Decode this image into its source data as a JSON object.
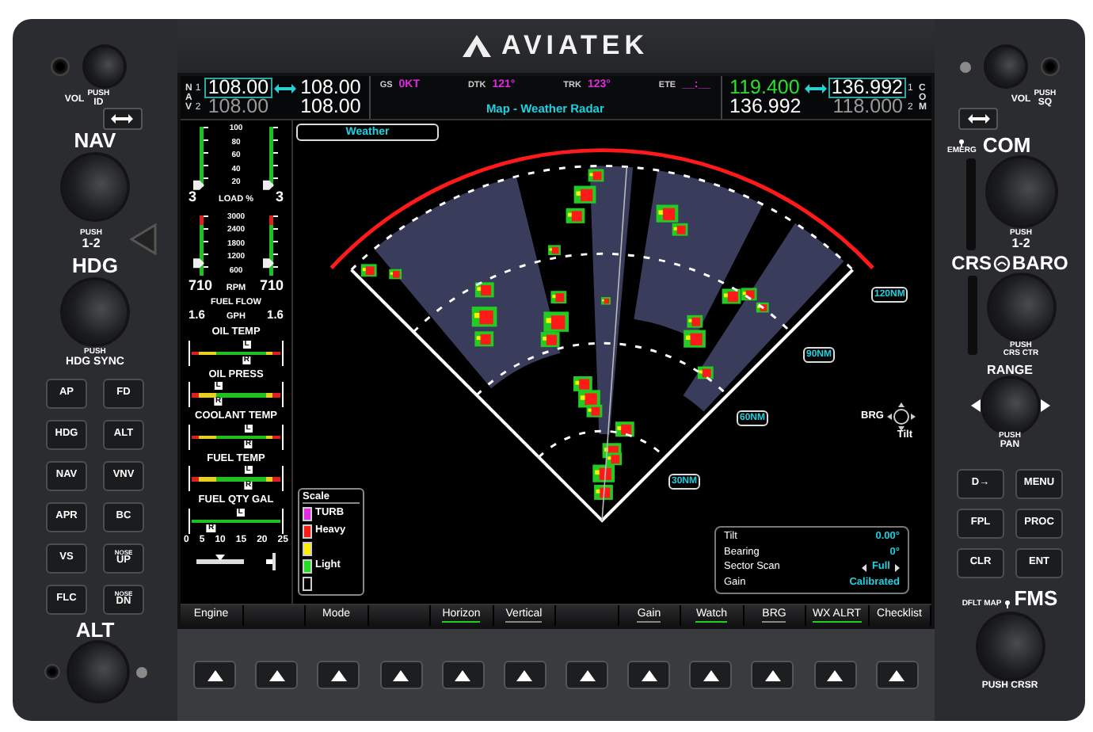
{
  "brand": {
    "name": "AVIATEK"
  },
  "left_bezel": {
    "volume": {
      "label": "VOL",
      "push": "PUSH",
      "sub": "ID"
    },
    "nav_knob": {
      "title": "NAV",
      "push": "PUSH",
      "sub": "1-2"
    },
    "hdg_knob": {
      "title": "HDG",
      "push": "PUSH",
      "sub": "HDG SYNC"
    },
    "buttons": [
      {
        "label": "AP"
      },
      {
        "label": "FD"
      },
      {
        "label": "HDG"
      },
      {
        "label": "ALT"
      },
      {
        "label": "NAV"
      },
      {
        "label": "VNV"
      },
      {
        "label": "APR"
      },
      {
        "label": "BC"
      },
      {
        "label": "VS"
      },
      {
        "small": "NOSE",
        "label": "UP"
      },
      {
        "label": "FLC"
      },
      {
        "small": "NOSE",
        "label": "DN"
      }
    ],
    "alt_knob": {
      "title": "ALT"
    }
  },
  "top_bar": {
    "nav": {
      "letters": [
        "N",
        "A",
        "V"
      ],
      "radios": [
        {
          "index": "1",
          "active": "108.00",
          "standby": "108.00",
          "selected": true
        },
        {
          "index": "2",
          "active": "108.00",
          "standby": "108.00",
          "selected": false
        }
      ]
    },
    "fields": [
      {
        "label": "GS",
        "value": "0KT"
      },
      {
        "label": "DTK",
        "value": "121°"
      },
      {
        "label": "TRK",
        "value": "123°"
      },
      {
        "label": "ETE",
        "value": "__:__"
      }
    ],
    "page_title": "Map - Weather Radar",
    "com": {
      "letters": [
        "C",
        "O",
        "M"
      ],
      "radios": [
        {
          "index": "1",
          "active": "119.400",
          "standby": "136.992",
          "selected": true
        },
        {
          "index": "2",
          "active": "136.992",
          "standby": "118.000",
          "selected": false
        }
      ]
    }
  },
  "engine": {
    "vertical_gauges": [
      {
        "ticks": [
          "100",
          "80",
          "60",
          "40",
          "20"
        ],
        "left_value": "3",
        "unit": "LOAD %",
        "right_value": "3",
        "kind": "load",
        "level": 0.03
      },
      {
        "ticks": [
          "3000",
          "2400",
          "1800",
          "1200",
          "600"
        ],
        "left_value": "710",
        "unit": "RPM",
        "right_value": "710",
        "kind": "rpm",
        "level": 0.22
      }
    ],
    "fuel_flow": {
      "label": "FUEL FLOW",
      "left_value": "1.6",
      "unit": "GPH",
      "right_value": "1.6"
    },
    "bar_gauges": [
      {
        "label": "OIL TEMP",
        "pointers": [
          {
            "tag": "L",
            "level": 0.62
          },
          {
            "tag": "R",
            "level": 0.62
          }
        ]
      },
      {
        "label": "OIL PRESS",
        "pointers": [
          {
            "tag": "L",
            "level": 0.3
          },
          {
            "tag": "R",
            "level": 0.3
          }
        ]
      },
      {
        "label": "COOLANT TEMP",
        "pointers": [
          {
            "tag": "L",
            "level": 0.64
          },
          {
            "tag": "R",
            "level": 0.64
          }
        ]
      },
      {
        "label": "FUEL TEMP",
        "pointers": [
          {
            "tag": "L",
            "level": 0.64
          },
          {
            "tag": "R",
            "level": 0.64
          }
        ]
      }
    ],
    "fuel_qty": {
      "label": "FUEL QTY GAL",
      "ticks": [
        "0",
        "5",
        "10",
        "15",
        "20",
        "25"
      ],
      "pointers": [
        {
          "tag": "L",
          "level": 0.55
        },
        {
          "tag": "R",
          "level": 0.22
        }
      ]
    }
  },
  "map": {
    "tab": "Weather",
    "range_labels": [
      "30NM",
      "60NM",
      "90NM",
      "120NM"
    ],
    "scale": {
      "title": "Scale",
      "items": [
        {
          "label": "TURB",
          "color": "#e22be2"
        },
        {
          "label": "Heavy",
          "color": "#ff1a1a"
        },
        {
          "color": "#ffee00"
        },
        {
          "label": "Light",
          "color": "#22dd22"
        },
        {
          "color": "#000000"
        }
      ]
    },
    "control": {
      "left": "BRG",
      "bottom": "Tilt"
    },
    "info": [
      {
        "label": "Tilt",
        "value": "0.00°",
        "kind": "value"
      },
      {
        "label": "Bearing",
        "value": "0°",
        "kind": "value"
      },
      {
        "label": "Sector Scan",
        "value": "Full",
        "kind": "selector"
      },
      {
        "label": "Gain",
        "value": "Calibrated",
        "kind": "value"
      }
    ]
  },
  "softkeys": [
    {
      "kind": "labeled",
      "label": "Engine"
    },
    {
      "kind": "blank"
    },
    {
      "kind": "labeled",
      "label": "Mode"
    },
    {
      "kind": "blank"
    },
    {
      "kind": "labeled",
      "label": "Horizon",
      "on": true
    },
    {
      "kind": "labeled",
      "label": "Vertical",
      "on": false
    },
    {
      "kind": "blank"
    },
    {
      "kind": "labeled",
      "label": "Gain",
      "on": false
    },
    {
      "kind": "labeled",
      "label": "Watch",
      "on": true
    },
    {
      "kind": "labeled",
      "label": "BRG",
      "on": false
    },
    {
      "kind": "labeled",
      "label": "WX ALRT",
      "on": true
    },
    {
      "kind": "labeled",
      "label": "Checklist"
    }
  ],
  "right_bezel": {
    "volume": {
      "label": "VOL",
      "push": "PUSH",
      "sub": "SQ"
    },
    "com_knob": {
      "emerg": "EMERG",
      "title": "COM",
      "push": "PUSH",
      "sub": "1-2"
    },
    "crs_knob": {
      "left": "CRS",
      "right": "BARO",
      "push": "PUSH",
      "sub": "CRS CTR"
    },
    "range_knob": {
      "title": "RANGE",
      "push": "PUSH",
      "sub": "PAN"
    },
    "buttons": [
      {
        "label": "D→"
      },
      {
        "label": "MENU"
      },
      {
        "label": "FPL"
      },
      {
        "label": "PROC"
      },
      {
        "label": "CLR"
      },
      {
        "label": "ENT"
      }
    ],
    "fms_knob": {
      "map": "DFLT MAP",
      "title": "FMS",
      "caption": "PUSH CRSR"
    }
  }
}
